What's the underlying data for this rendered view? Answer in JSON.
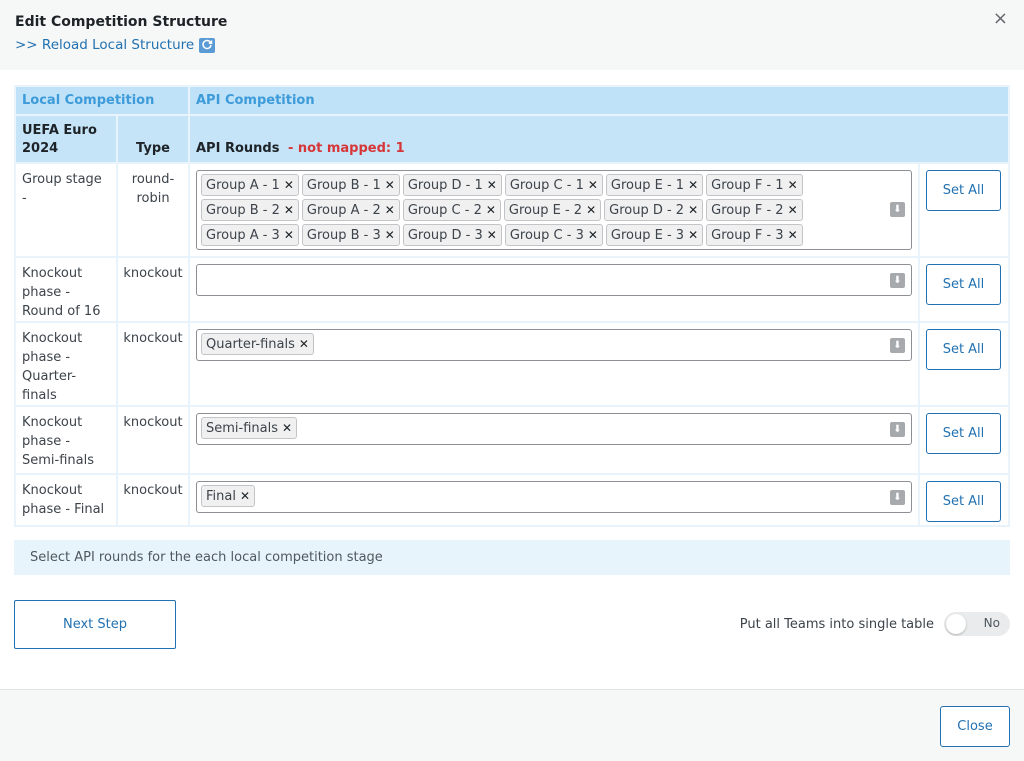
{
  "header": {
    "title": "Edit Competition Structure",
    "reload_link": ">> Reload Local Structure",
    "reload_icon": "refresh-icon",
    "close_icon": "×"
  },
  "table": {
    "col_local": "Local Competition",
    "col_api": "API Competition",
    "local_name": "UEFA Euro 2024",
    "type_header": "Type",
    "api_rounds_header": "API Rounds",
    "not_mapped": "- not mapped: 1",
    "set_all_label": "Set All",
    "rows": [
      {
        "name": "Group stage -",
        "type": "round-robin",
        "tags": [
          "Group A - 1",
          "Group B - 1",
          "Group D - 1",
          "Group C - 1",
          "Group E - 1",
          "Group F - 1",
          "Group B - 2",
          "Group A - 2",
          "Group C - 2",
          "Group E - 2",
          "Group D - 2",
          "Group F - 2",
          "Group A - 3",
          "Group B - 3",
          "Group D - 3",
          "Group C - 3",
          "Group E - 3",
          "Group F - 3"
        ]
      },
      {
        "name": "Knockout phase - Round of 16",
        "type": "knockout",
        "tags": []
      },
      {
        "name": "Knockout phase - Quarter-finals",
        "type": "knockout",
        "tags": [
          "Quarter-finals"
        ]
      },
      {
        "name": "Knockout phase - Semi-finals",
        "type": "knockout",
        "tags": [
          "Semi-finals"
        ]
      },
      {
        "name": "Knockout phase - Final",
        "type": "knockout",
        "tags": [
          "Final"
        ]
      }
    ]
  },
  "hint": "Select API rounds for the each local competition stage",
  "next_step_label": "Next Step",
  "toggle": {
    "label": "Put all Teams into single table",
    "value": "No"
  },
  "footer": {
    "close_label": "Close"
  },
  "colors": {
    "accent": "#2271b1",
    "header_blue": "#bfe2f9",
    "error": "#d63638"
  }
}
